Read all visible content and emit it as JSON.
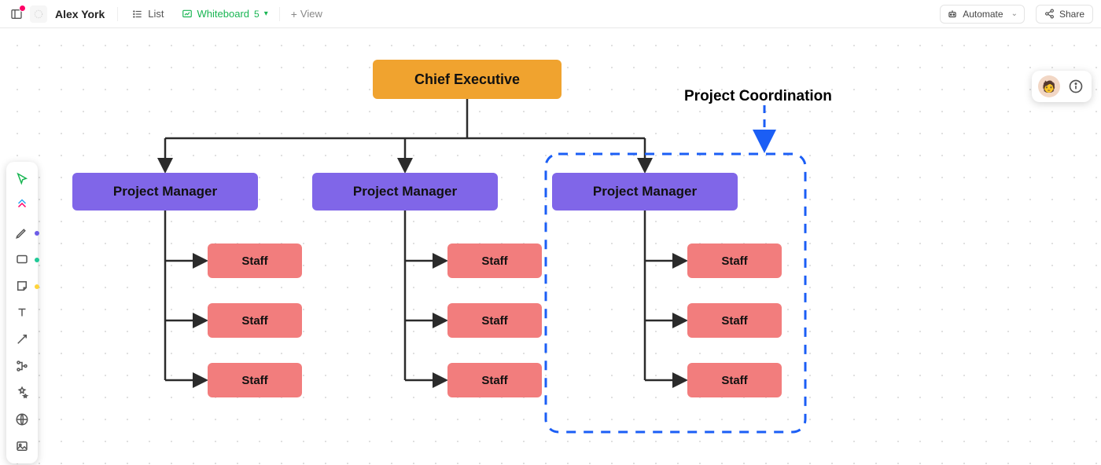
{
  "header": {
    "username": "Alex York",
    "tabs": {
      "list": {
        "label": "List"
      },
      "whiteboard": {
        "label": "Whiteboard",
        "count": "5"
      },
      "add": {
        "label": "View"
      }
    },
    "automate": "Automate",
    "share": "Share"
  },
  "toolbar_icons": [
    "cursor",
    "shapes",
    "pen",
    "square",
    "sticky",
    "text",
    "connector",
    "schema",
    "ai",
    "globe",
    "image"
  ],
  "annotation": {
    "label": "Project Coordination"
  },
  "org": {
    "root": "Chief Executive",
    "branches": [
      {
        "manager": "Project Manager",
        "staff": [
          "Staff",
          "Staff",
          "Staff"
        ]
      },
      {
        "manager": "Project Manager",
        "staff": [
          "Staff",
          "Staff",
          "Staff"
        ]
      },
      {
        "manager": "Project Manager",
        "staff": [
          "Staff",
          "Staff",
          "Staff"
        ]
      }
    ]
  },
  "colors": {
    "exec": "#f0a32f",
    "pm": "#8066e8",
    "staff": "#f27d7d",
    "selection": "#1b5ef5",
    "accent": "#18b552"
  }
}
